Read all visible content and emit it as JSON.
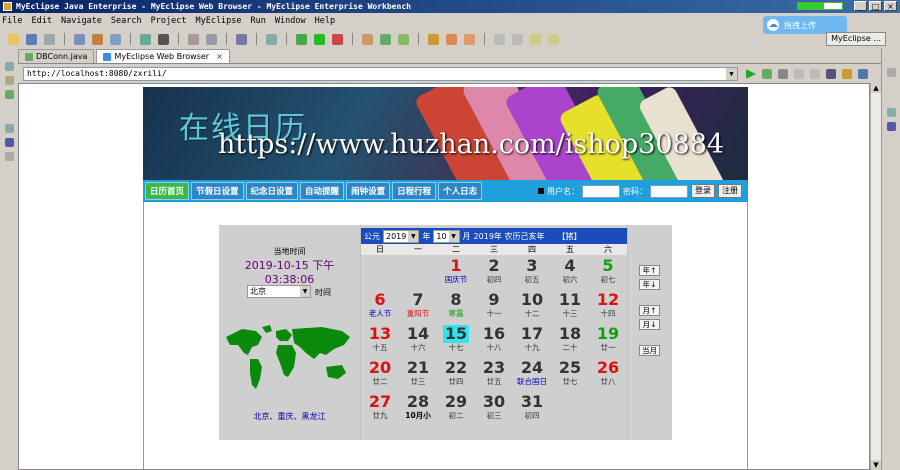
{
  "window": {
    "title": "MyEclipse Java Enterprise - MyEclipse Web Browser - MyEclipse Enterprise Workbench"
  },
  "menu": [
    "File",
    "Edit",
    "Navigate",
    "Search",
    "Project",
    "MyEclipse",
    "Run",
    "Window",
    "Help"
  ],
  "cloud_button": "拖拽上传",
  "perspective": "MyEclipse ...",
  "tabs": [
    {
      "label": "DBConn.java"
    },
    {
      "label": "MyEclipse Web Browser"
    }
  ],
  "address": "http://localhost:8080/zxrili/",
  "banner": {
    "title": "在线日历",
    "watermark": "https://www.huzhan.com/ishop30884"
  },
  "nav": [
    "日历首页",
    "节假日设置",
    "纪念日设置",
    "自动提醒",
    "闹钟设置",
    "日程行程",
    "个人日志"
  ],
  "login": {
    "user_label": "用户名：",
    "pass_label": "密码：",
    "login_btn": "登录",
    "register_btn": "注册"
  },
  "clock": {
    "label": "当地时间",
    "time": "2019-10-15 下午 03:38:06",
    "city": "北京",
    "time_label": "时间",
    "cities": "北京、重庆、黑龙江"
  },
  "calendar": {
    "era_label": "公元",
    "year": "2019",
    "year_unit": "年",
    "month": "10",
    "month_unit": "月",
    "lunar_info": "2019年  农历己亥年",
    "zodiac": "【猪】",
    "weekdays": [
      "日",
      "一",
      "二",
      "三",
      "四",
      "五",
      "六"
    ],
    "days": [
      {
        "d": "1",
        "l": "国庆节",
        "c": "red",
        "lc": "blue"
      },
      {
        "d": "2",
        "l": "初四"
      },
      {
        "d": "3",
        "l": "初五"
      },
      {
        "d": "4",
        "l": "初六"
      },
      {
        "d": "5",
        "l": "初七",
        "c": "green"
      },
      {
        "d": "6",
        "l": "老人节",
        "c": "red",
        "lc": "blue"
      },
      {
        "d": "7",
        "l": "重阳节",
        "lc": "red"
      },
      {
        "d": "8",
        "l": "寒露",
        "lc": "green"
      },
      {
        "d": "9",
        "l": "十一"
      },
      {
        "d": "10",
        "l": "十二"
      },
      {
        "d": "11",
        "l": "十三"
      },
      {
        "d": "12",
        "l": "十四",
        "c": "red"
      },
      {
        "d": "13",
        "l": "十五",
        "c": "red"
      },
      {
        "d": "14",
        "l": "十六"
      },
      {
        "d": "15",
        "l": "十七",
        "today": true
      },
      {
        "d": "16",
        "l": "十八"
      },
      {
        "d": "17",
        "l": "十九"
      },
      {
        "d": "18",
        "l": "二十"
      },
      {
        "d": "19",
        "l": "廿一",
        "c": "green"
      },
      {
        "d": "20",
        "l": "廿二",
        "c": "red"
      },
      {
        "d": "21",
        "l": "廿三"
      },
      {
        "d": "22",
        "l": "廿四"
      },
      {
        "d": "23",
        "l": "廿五"
      },
      {
        "d": "24",
        "l": "联合国日",
        "lc": "blue"
      },
      {
        "d": "25",
        "l": "廿七"
      },
      {
        "d": "26",
        "l": "廿八",
        "c": "red"
      },
      {
        "d": "27",
        "l": "廿九",
        "c": "red"
      },
      {
        "d": "28",
        "l": "10月小",
        "lc": "bold"
      },
      {
        "d": "29",
        "l": "初二"
      },
      {
        "d": "30",
        "l": "初三"
      },
      {
        "d": "31",
        "l": "初四"
      }
    ],
    "first_weekday": 2,
    "buttons": {
      "year_up": "年↑",
      "year_down": "年↓",
      "month_up": "月↑",
      "month_down": "月↓",
      "this_month": "当月"
    }
  }
}
